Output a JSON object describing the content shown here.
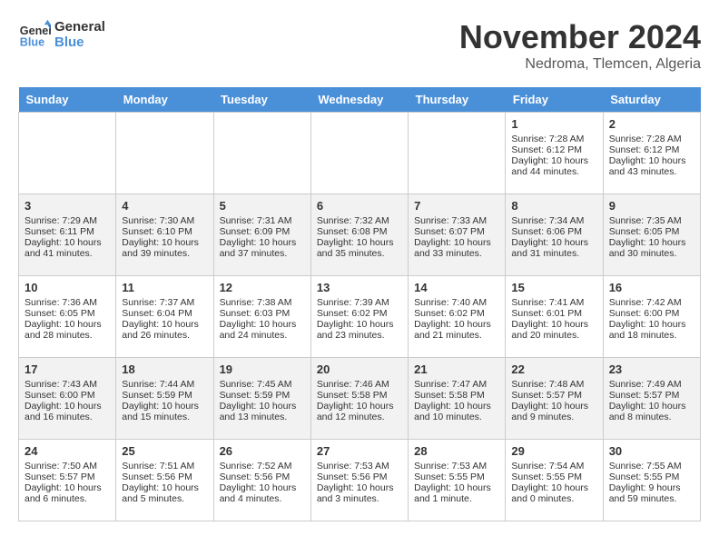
{
  "logo": {
    "line1": "General",
    "line2": "Blue"
  },
  "title": "November 2024",
  "location": "Nedroma, Tlemcen, Algeria",
  "weekdays": [
    "Sunday",
    "Monday",
    "Tuesday",
    "Wednesday",
    "Thursday",
    "Friday",
    "Saturday"
  ],
  "weeks": [
    [
      {
        "day": "",
        "info": ""
      },
      {
        "day": "",
        "info": ""
      },
      {
        "day": "",
        "info": ""
      },
      {
        "day": "",
        "info": ""
      },
      {
        "day": "",
        "info": ""
      },
      {
        "day": "1",
        "info": "Sunrise: 7:28 AM\nSunset: 6:12 PM\nDaylight: 10 hours\nand 44 minutes."
      },
      {
        "day": "2",
        "info": "Sunrise: 7:28 AM\nSunset: 6:12 PM\nDaylight: 10 hours\nand 43 minutes."
      }
    ],
    [
      {
        "day": "3",
        "info": "Sunrise: 7:29 AM\nSunset: 6:11 PM\nDaylight: 10 hours\nand 41 minutes."
      },
      {
        "day": "4",
        "info": "Sunrise: 7:30 AM\nSunset: 6:10 PM\nDaylight: 10 hours\nand 39 minutes."
      },
      {
        "day": "5",
        "info": "Sunrise: 7:31 AM\nSunset: 6:09 PM\nDaylight: 10 hours\nand 37 minutes."
      },
      {
        "day": "6",
        "info": "Sunrise: 7:32 AM\nSunset: 6:08 PM\nDaylight: 10 hours\nand 35 minutes."
      },
      {
        "day": "7",
        "info": "Sunrise: 7:33 AM\nSunset: 6:07 PM\nDaylight: 10 hours\nand 33 minutes."
      },
      {
        "day": "8",
        "info": "Sunrise: 7:34 AM\nSunset: 6:06 PM\nDaylight: 10 hours\nand 31 minutes."
      },
      {
        "day": "9",
        "info": "Sunrise: 7:35 AM\nSunset: 6:05 PM\nDaylight: 10 hours\nand 30 minutes."
      }
    ],
    [
      {
        "day": "10",
        "info": "Sunrise: 7:36 AM\nSunset: 6:05 PM\nDaylight: 10 hours\nand 28 minutes."
      },
      {
        "day": "11",
        "info": "Sunrise: 7:37 AM\nSunset: 6:04 PM\nDaylight: 10 hours\nand 26 minutes."
      },
      {
        "day": "12",
        "info": "Sunrise: 7:38 AM\nSunset: 6:03 PM\nDaylight: 10 hours\nand 24 minutes."
      },
      {
        "day": "13",
        "info": "Sunrise: 7:39 AM\nSunset: 6:02 PM\nDaylight: 10 hours\nand 23 minutes."
      },
      {
        "day": "14",
        "info": "Sunrise: 7:40 AM\nSunset: 6:02 PM\nDaylight: 10 hours\nand 21 minutes."
      },
      {
        "day": "15",
        "info": "Sunrise: 7:41 AM\nSunset: 6:01 PM\nDaylight: 10 hours\nand 20 minutes."
      },
      {
        "day": "16",
        "info": "Sunrise: 7:42 AM\nSunset: 6:00 PM\nDaylight: 10 hours\nand 18 minutes."
      }
    ],
    [
      {
        "day": "17",
        "info": "Sunrise: 7:43 AM\nSunset: 6:00 PM\nDaylight: 10 hours\nand 16 minutes."
      },
      {
        "day": "18",
        "info": "Sunrise: 7:44 AM\nSunset: 5:59 PM\nDaylight: 10 hours\nand 15 minutes."
      },
      {
        "day": "19",
        "info": "Sunrise: 7:45 AM\nSunset: 5:59 PM\nDaylight: 10 hours\nand 13 minutes."
      },
      {
        "day": "20",
        "info": "Sunrise: 7:46 AM\nSunset: 5:58 PM\nDaylight: 10 hours\nand 12 minutes."
      },
      {
        "day": "21",
        "info": "Sunrise: 7:47 AM\nSunset: 5:58 PM\nDaylight: 10 hours\nand 10 minutes."
      },
      {
        "day": "22",
        "info": "Sunrise: 7:48 AM\nSunset: 5:57 PM\nDaylight: 10 hours\nand 9 minutes."
      },
      {
        "day": "23",
        "info": "Sunrise: 7:49 AM\nSunset: 5:57 PM\nDaylight: 10 hours\nand 8 minutes."
      }
    ],
    [
      {
        "day": "24",
        "info": "Sunrise: 7:50 AM\nSunset: 5:57 PM\nDaylight: 10 hours\nand 6 minutes."
      },
      {
        "day": "25",
        "info": "Sunrise: 7:51 AM\nSunset: 5:56 PM\nDaylight: 10 hours\nand 5 minutes."
      },
      {
        "day": "26",
        "info": "Sunrise: 7:52 AM\nSunset: 5:56 PM\nDaylight: 10 hours\nand 4 minutes."
      },
      {
        "day": "27",
        "info": "Sunrise: 7:53 AM\nSunset: 5:56 PM\nDaylight: 10 hours\nand 3 minutes."
      },
      {
        "day": "28",
        "info": "Sunrise: 7:53 AM\nSunset: 5:55 PM\nDaylight: 10 hours\nand 1 minute."
      },
      {
        "day": "29",
        "info": "Sunrise: 7:54 AM\nSunset: 5:55 PM\nDaylight: 10 hours\nand 0 minutes."
      },
      {
        "day": "30",
        "info": "Sunrise: 7:55 AM\nSunset: 5:55 PM\nDaylight: 9 hours\nand 59 minutes."
      }
    ]
  ]
}
